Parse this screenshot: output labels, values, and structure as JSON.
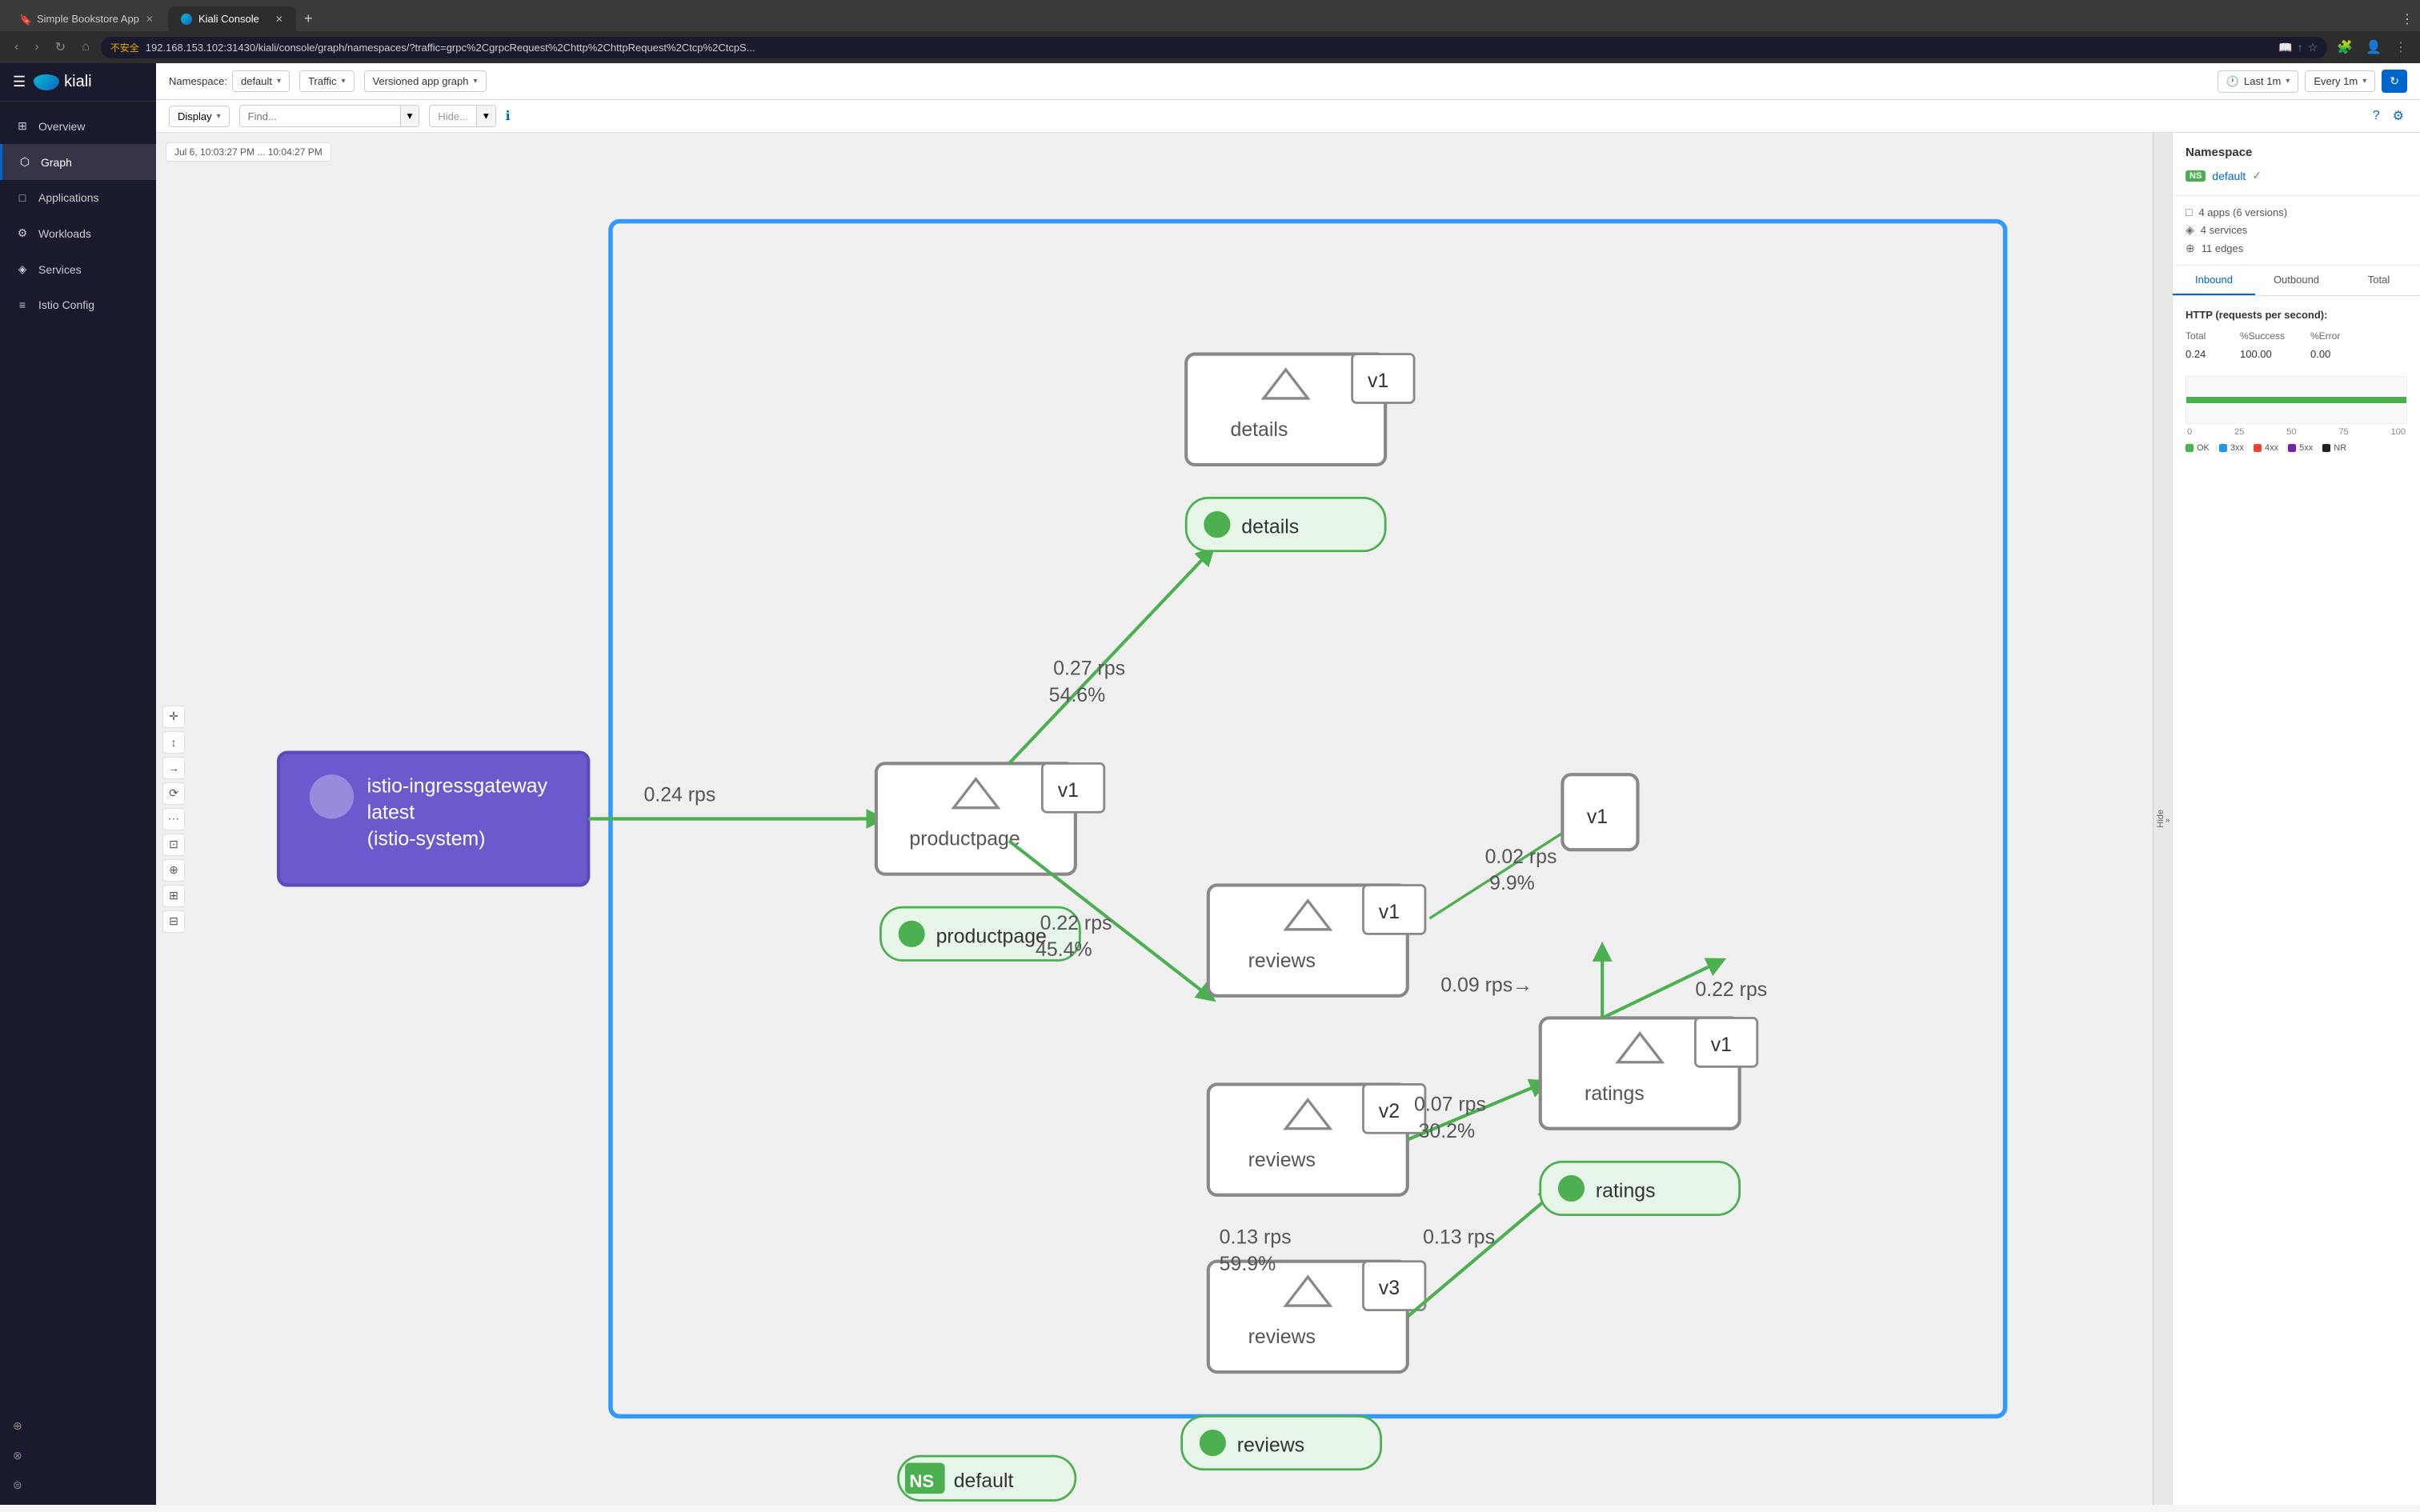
{
  "browser": {
    "tabs": [
      {
        "id": "tab1",
        "title": "Simple Bookstore App",
        "active": false,
        "favicon": "🔖"
      },
      {
        "id": "tab2",
        "title": "Kiali Console",
        "active": true,
        "favicon": "🔵"
      }
    ],
    "address": "192.168.153.102:31430/kiali/console/graph/namespaces/?traffic=grpc%2CgrpcRequest%2Chttp%2ChttpRequest%2Ctcp%2CtcpS...",
    "warning_text": "不安全",
    "new_tab_label": "+"
  },
  "app": {
    "title": "kiali"
  },
  "sidebar": {
    "items": [
      {
        "id": "overview",
        "label": "Overview",
        "icon": "⊞"
      },
      {
        "id": "graph",
        "label": "Graph",
        "icon": "⬡",
        "active": true
      },
      {
        "id": "applications",
        "label": "Applications",
        "icon": "□"
      },
      {
        "id": "workloads",
        "label": "Workloads",
        "icon": "⚙"
      },
      {
        "id": "services",
        "label": "Services",
        "icon": "◈"
      },
      {
        "id": "istio-config",
        "label": "Istio Config",
        "icon": "≡"
      }
    ]
  },
  "toolbar": {
    "namespace_label": "Namespace:",
    "namespace_value": "default",
    "traffic_label": "Traffic",
    "graph_type_label": "Versioned app graph",
    "last_time_label": "Last 1m",
    "every_time_label": "Every 1m",
    "refresh_icon": "↻",
    "display_label": "Display",
    "find_placeholder": "Find...",
    "hide_placeholder": "Hide...",
    "info_icon": "ℹ"
  },
  "graph": {
    "timestamp": "Jul 6, 10:03:27 PM ... 10:04:27 PM",
    "namespace_badge": "NS",
    "namespace_name": "default",
    "nodes": {
      "productpage": {
        "label": "productpage",
        "version": "v1",
        "type": "app"
      },
      "details": {
        "label": "details",
        "version": "v1",
        "type": "app"
      },
      "reviews_v1": {
        "label": "reviews",
        "version": "v1",
        "type": "workload"
      },
      "reviews_v2": {
        "label": "reviews",
        "version": "v2",
        "type": "workload"
      },
      "reviews_v3": {
        "label": "reviews",
        "version": "v3",
        "type": "workload"
      },
      "ratings": {
        "label": "ratings",
        "version": "v1",
        "type": "app"
      },
      "gateway": {
        "label": "istio-ingressgateway\nlatest\n(istio-system)",
        "type": "gateway"
      }
    },
    "edges": [
      {
        "from": "gateway",
        "to": "productpage",
        "rps": "0.24 rps"
      },
      {
        "from": "productpage",
        "to": "details",
        "rps": "0.27 rps",
        "success": "54.6%"
      },
      {
        "from": "productpage",
        "to": "reviews",
        "rps": "0.22 rps",
        "success": "45.4%"
      },
      {
        "from": "reviews_v2",
        "to": "ratings",
        "rps": "0.07 rps",
        "success": "30.2%"
      },
      {
        "from": "reviews_v3",
        "to": "ratings",
        "rps": "0.13 rps"
      }
    ]
  },
  "right_panel": {
    "title": "Namespace",
    "ns_badge": "NS",
    "ns_name": "default",
    "ns_check": "✓",
    "stats": {
      "apps": "4 apps (6 versions)",
      "services": "4 services",
      "edges": "11 edges"
    },
    "tabs": [
      {
        "id": "inbound",
        "label": "Inbound",
        "active": true
      },
      {
        "id": "outbound",
        "label": "Outbound",
        "active": false
      },
      {
        "id": "total",
        "label": "Total",
        "active": false
      }
    ],
    "metrics": {
      "title": "HTTP (requests per second):",
      "headers": [
        "Total",
        "%Success",
        "%Error"
      ],
      "values": [
        "0.24",
        "100.00",
        "0.00"
      ]
    },
    "chart": {
      "axis_labels": [
        "0",
        "25",
        "50",
        "75",
        "100"
      ],
      "legend": [
        {
          "label": "OK",
          "color": "#4caf50"
        },
        {
          "label": "3xx",
          "color": "#2196f3"
        },
        {
          "label": "4xx",
          "color": "#f44336"
        },
        {
          "label": "5xx",
          "color": "#7b1fa2"
        },
        {
          "label": "NR",
          "color": "#212121"
        }
      ]
    }
  },
  "hide_panel": {
    "label": "Hide",
    "arrow": "»"
  }
}
